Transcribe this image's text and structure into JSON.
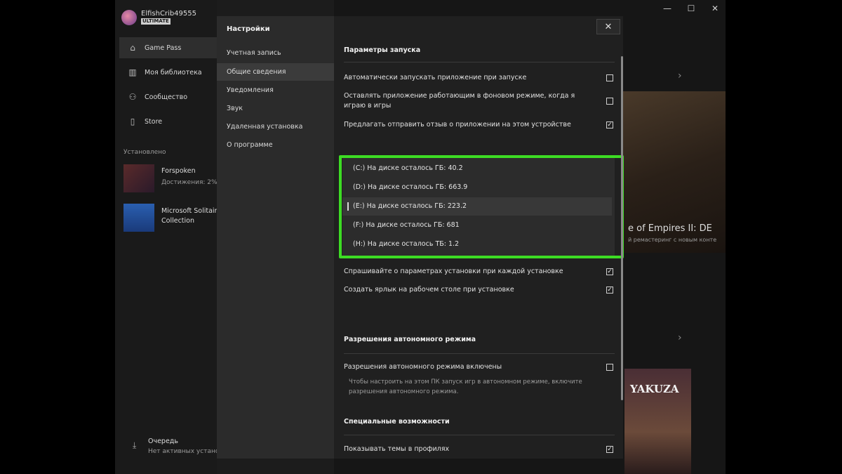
{
  "window": {
    "minimize": "—",
    "maximize": "☐",
    "close": "✕"
  },
  "user": {
    "name": "ElfishCrib49555",
    "badge": "ULTIMATE"
  },
  "sidebar": {
    "items": [
      {
        "label": "Game Pass",
        "icon": "home-icon"
      },
      {
        "label": "Моя библиотека",
        "icon": "library-icon"
      },
      {
        "label": "Сообщество",
        "icon": "community-icon"
      },
      {
        "label": "Store",
        "icon": "store-icon"
      }
    ],
    "installed_label": "Установлено",
    "games": [
      {
        "title": "Forspoken",
        "sub": "Достижения: 2%"
      },
      {
        "title": "Microsoft Solitaire",
        "sub": "Collection"
      }
    ],
    "queue_label": "Очередь",
    "queue_sub": "Нет активных устано"
  },
  "background": {
    "game_title": "e of Empires II: DE",
    "game_sub": "й ремастеринг с новым конте",
    "game2": "YAKUZA"
  },
  "settings": {
    "title": "Настройки",
    "close": "✕",
    "menu": [
      "Учетная запись",
      "Общие сведения",
      "Уведомления",
      "Звук",
      "Удаленная установка",
      "О программе"
    ],
    "launch_section": "Параметры запуска",
    "launch_rows": [
      {
        "label": "Автоматически запускать приложение при запуске",
        "checked": false
      },
      {
        "label": "Оставлять приложение работающим в фоновом режиме, когда я играю в игры",
        "checked": false
      },
      {
        "label": "Предлагать отправить отзыв о приложении на этом устройстве",
        "checked": true
      }
    ],
    "drives": [
      "(C:) На диске осталось ГБ: 40.2",
      "(D:) На диске осталось ГБ: 663.9",
      "(E:) На диске осталось ГБ: 223.2",
      "(F:) На диске осталось ГБ: 681",
      "(H:) На диске осталось ТБ: 1.2"
    ],
    "selected_drive": 2,
    "install_rows": [
      {
        "label": "Спрашивайте о параметрах установки при каждой установке",
        "checked": true
      },
      {
        "label": "Создать ярлык на рабочем столе при установке",
        "checked": true
      }
    ],
    "offline_section": "Разрешения автономного режима",
    "offline_row": {
      "label": "Разрешения автономного режима включены",
      "checked": false
    },
    "offline_note": "Чтобы настроить на этом ПК запуск игр в автономном режиме, включите разрешения автономного режима.",
    "access_section": "Специальные возможности",
    "access_row": {
      "label": "Показывать темы в профилях",
      "checked": true
    },
    "check_mark": "✓"
  },
  "colors": {
    "highlight": "#3ddc24"
  }
}
